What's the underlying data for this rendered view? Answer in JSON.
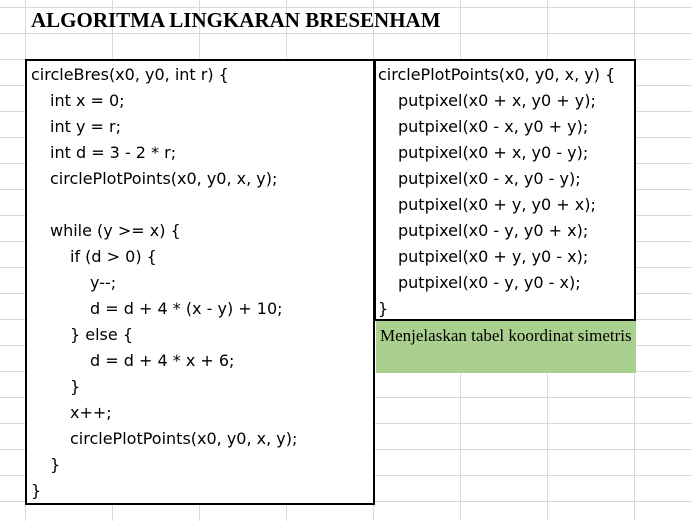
{
  "title": "ALGORITMA LINGKARAN BRESENHAM",
  "left_code": [
    "circleBres(x0, y0, int r) {",
    "int x = 0;",
    "int y = r;",
    "int d = 3 - 2 * r;",
    "circlePlotPoints(x0, y0, x, y);",
    "",
    "while (y >= x) {",
    "if (d > 0) {",
    "y--;",
    "d = d + 4 * (x - y) + 10;",
    "} else {",
    "d = d + 4 * x + 6;",
    "}",
    "x++;",
    "circlePlotPoints(x0, y0, x, y);",
    "}",
    "}"
  ],
  "right_code": [
    "circlePlotPoints(x0, y0, x, y) {",
    "putpixel(x0 + x, y0 + y);",
    "putpixel(x0 - x, y0 + y);",
    "putpixel(x0 + x, y0 - y);",
    "putpixel(x0 - x, y0 - y);",
    "putpixel(x0 + y, y0 + x);",
    "putpixel(x0 - y, y0 + x);",
    "putpixel(x0 + y, y0 - x);",
    "putpixel(x0 - y, y0 - x);",
    "}"
  ],
  "note": "Menjelaskan tabel koordinat simetris",
  "colors": {
    "note_bg": "#a9d08e",
    "gridline": "#d9d9d9"
  }
}
